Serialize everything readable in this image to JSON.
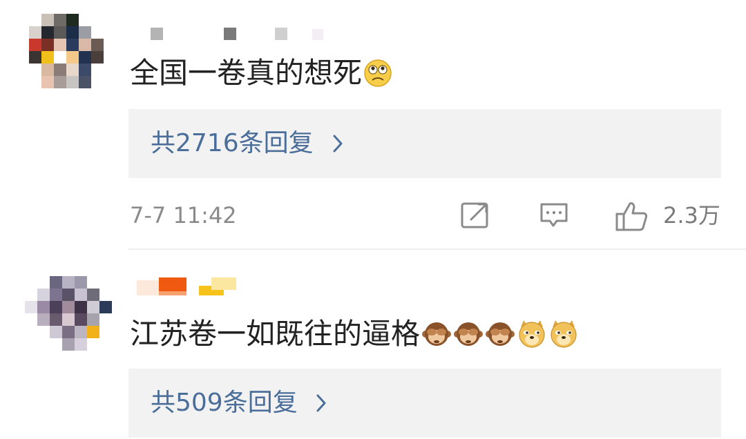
{
  "comments": [
    {
      "username": "",
      "text": "全国一卷真的想死",
      "emojis": [
        "crying-face-icon"
      ],
      "replies_label": "共2716条回复",
      "timestamp": "7-7 11:42",
      "like_count": "2.3万"
    },
    {
      "username": "",
      "text": "江苏卷一如既往的逼格",
      "emojis": [
        "see-no-evil-monkey-icon",
        "see-no-evil-monkey-icon",
        "see-no-evil-monkey-icon",
        "doge-icon",
        "doge-icon"
      ],
      "replies_label": "共509条回复"
    }
  ],
  "colors": {
    "reply_link": "#4a6e99",
    "reply_bg": "#f2f2f2",
    "meta_text": "#8a8a8a",
    "comment_text": "#222222"
  }
}
